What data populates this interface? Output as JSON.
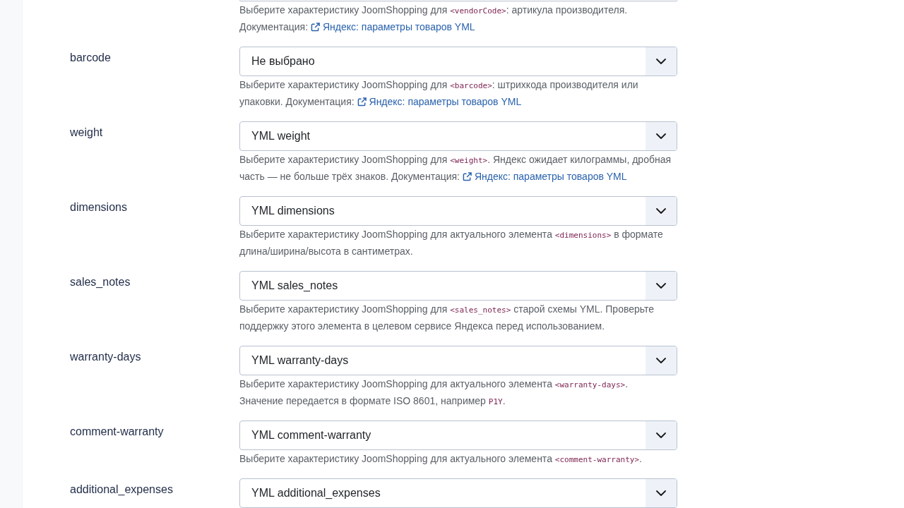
{
  "cut_off_field": {
    "help": [
      {
        "kind": "text",
        "text": "Выберите характеристику JoomShopping для "
      },
      {
        "kind": "code",
        "text": "<vendorCode>"
      },
      {
        "kind": "text",
        "text": ": артикула производителя. Документация: "
      },
      {
        "kind": "link",
        "text": "Яндекс: параметры товаров YML"
      }
    ]
  },
  "fields": [
    {
      "label": "barcode",
      "value": "Не выбрано",
      "help": [
        {
          "kind": "text",
          "text": "Выберите характеристику JoomShopping для "
        },
        {
          "kind": "code",
          "text": "<barcode>"
        },
        {
          "kind": "text",
          "text": ": штрихкода производителя или упаковки. Документация: "
        },
        {
          "kind": "link",
          "text": "Яндекс: параметры товаров YML"
        }
      ]
    },
    {
      "label": "weight",
      "value": "YML weight",
      "help": [
        {
          "kind": "text",
          "text": "Выберите характеристику JoomShopping для "
        },
        {
          "kind": "code",
          "text": "<weight>"
        },
        {
          "kind": "text",
          "text": ". Яндекс ожидает килограммы, дробная часть — не больше трёх знаков. Документация: "
        },
        {
          "kind": "link",
          "text": "Яндекс: параметры товаров YML"
        }
      ]
    },
    {
      "label": "dimensions",
      "value": "YML dimensions",
      "help": [
        {
          "kind": "text",
          "text": "Выберите характеристику JoomShopping для актуального элемента "
        },
        {
          "kind": "code",
          "text": "<dimensions>"
        },
        {
          "kind": "text",
          "text": " в формате длина/ширина/высота в сантиметрах."
        }
      ]
    },
    {
      "label": "sales_notes",
      "value": "YML sales_notes",
      "help": [
        {
          "kind": "text",
          "text": "Выберите характеристику JoomShopping для "
        },
        {
          "kind": "code",
          "text": "<sales_notes>"
        },
        {
          "kind": "text",
          "text": " старой схемы YML. Проверьте поддержку этого элемента в целевом сервисе Яндекса перед использованием."
        }
      ]
    },
    {
      "label": "warranty-days",
      "value": "YML warranty-days",
      "help": [
        {
          "kind": "text",
          "text": "Выберите характеристику JoomShopping для актуального элемента "
        },
        {
          "kind": "code",
          "text": "<warranty-days>"
        },
        {
          "kind": "text",
          "text": ". Значение передается в формате ISO 8601, например "
        },
        {
          "kind": "code",
          "text": "P1Y"
        },
        {
          "kind": "text",
          "text": "."
        }
      ]
    },
    {
      "label": "comment-warranty",
      "value": "YML comment-warranty",
      "help": [
        {
          "kind": "text",
          "text": "Выберите характеристику JoomShopping для актуального элемента "
        },
        {
          "kind": "code",
          "text": "<comment-warranty>"
        },
        {
          "kind": "text",
          "text": "."
        }
      ]
    },
    {
      "label": "additional_expenses",
      "value": "YML additional_expenses"
    }
  ]
}
